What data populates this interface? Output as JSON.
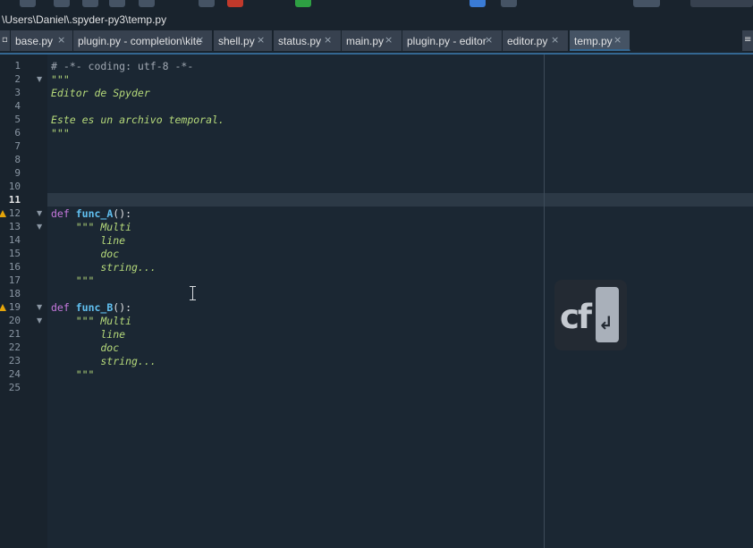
{
  "window": {
    "path": "\\Users\\Daniel\\.spyder-py3\\temp.py"
  },
  "tabs": [
    {
      "label": "base.py",
      "active": false
    },
    {
      "label": "plugin.py - completion\\kite",
      "active": false
    },
    {
      "label": "shell.py",
      "active": false
    },
    {
      "label": "status.py",
      "active": false
    },
    {
      "label": "main.py",
      "active": false
    },
    {
      "label": "plugin.py - editor",
      "active": false
    },
    {
      "label": "editor.py",
      "active": false
    },
    {
      "label": "temp.py",
      "active": true
    }
  ],
  "tab_close_glyph": "×",
  "editor": {
    "current_line": 11,
    "lines": [
      {
        "n": "1",
        "parts": [
          {
            "t": "# -*- coding: utf-8 -*-",
            "c": "comment"
          }
        ]
      },
      {
        "n": "2",
        "parts": [
          {
            "t": "\"\"\"",
            "c": "str"
          }
        ],
        "fold": true
      },
      {
        "n": "3",
        "parts": [
          {
            "t": "Editor de Spyder",
            "c": "str"
          }
        ]
      },
      {
        "n": "4",
        "parts": []
      },
      {
        "n": "5",
        "parts": [
          {
            "t": "Este es un archivo temporal.",
            "c": "str"
          }
        ]
      },
      {
        "n": "6",
        "parts": [
          {
            "t": "\"\"\"",
            "c": "str"
          }
        ]
      },
      {
        "n": "7",
        "parts": []
      },
      {
        "n": "8",
        "parts": []
      },
      {
        "n": "9",
        "parts": []
      },
      {
        "n": "10",
        "parts": []
      },
      {
        "n": "11",
        "parts": []
      },
      {
        "n": "12",
        "parts": [
          {
            "t": "def",
            "c": "kw"
          },
          {
            "t": " ",
            "c": "plain"
          },
          {
            "t": "func_A",
            "c": "def"
          },
          {
            "t": "():",
            "c": "plain"
          }
        ],
        "fold": true,
        "warn": true
      },
      {
        "n": "13",
        "parts": [
          {
            "t": "    \"\"\" Multi",
            "c": "str"
          }
        ],
        "fold": true
      },
      {
        "n": "14",
        "parts": [
          {
            "t": "        line",
            "c": "str"
          }
        ]
      },
      {
        "n": "15",
        "parts": [
          {
            "t": "        doc",
            "c": "str"
          }
        ]
      },
      {
        "n": "16",
        "parts": [
          {
            "t": "        string...",
            "c": "str"
          }
        ]
      },
      {
        "n": "17",
        "parts": [
          {
            "t": "    \"\"\"",
            "c": "str"
          }
        ]
      },
      {
        "n": "18",
        "parts": []
      },
      {
        "n": "19",
        "parts": [
          {
            "t": "def",
            "c": "kw"
          },
          {
            "t": " ",
            "c": "plain"
          },
          {
            "t": "func_B",
            "c": "def"
          },
          {
            "t": "():",
            "c": "plain"
          }
        ],
        "fold": true,
        "warn": true
      },
      {
        "n": "20",
        "parts": [
          {
            "t": "    \"\"\" Multi",
            "c": "str"
          }
        ],
        "fold": true
      },
      {
        "n": "21",
        "parts": [
          {
            "t": "        line",
            "c": "str"
          }
        ]
      },
      {
        "n": "22",
        "parts": [
          {
            "t": "        doc",
            "c": "str"
          }
        ]
      },
      {
        "n": "23",
        "parts": [
          {
            "t": "        string...",
            "c": "str"
          }
        ]
      },
      {
        "n": "24",
        "parts": [
          {
            "t": "    \"\"\"",
            "c": "str"
          }
        ]
      },
      {
        "n": "25",
        "parts": []
      }
    ]
  },
  "overlay": {
    "logo_text": "cf",
    "key_glyph": "↲"
  },
  "colors": {
    "background": "#19232d",
    "accent": "#346792",
    "keyword": "#c678dd",
    "function_name": "#61c0f0",
    "string": "#b5d97a",
    "comment": "#a0a8b2",
    "warning": "#e5a50a"
  }
}
